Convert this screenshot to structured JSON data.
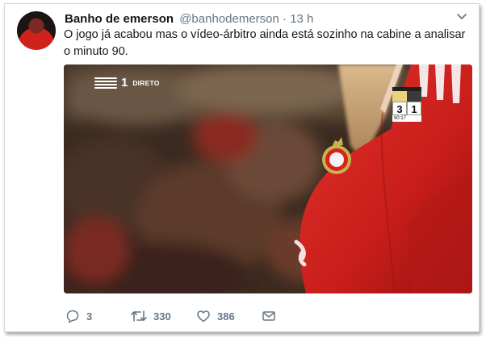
{
  "tweet": {
    "display_name": "Banho de emerson",
    "handle": "@banhodemerson",
    "separator": "·",
    "time_ago": "13 h",
    "text": "O jogo já acabou mas o vídeo-árbitro ainda está sozinho na cabine a analisar o minuto 90."
  },
  "media": {
    "channel_number": "1",
    "live_label": "DIRETO",
    "scoreboard": {
      "home_score": "3",
      "away_score": "1",
      "clock": "90:17"
    }
  },
  "actions": {
    "replies": "3",
    "retweets": "330",
    "likes": "386"
  },
  "colors": {
    "text": "#14171a",
    "muted": "#657786",
    "jersey_red": "#d41f1c"
  },
  "icons": [
    "chevron-down-icon",
    "reply-icon",
    "retweet-icon",
    "like-icon",
    "message-icon"
  ]
}
